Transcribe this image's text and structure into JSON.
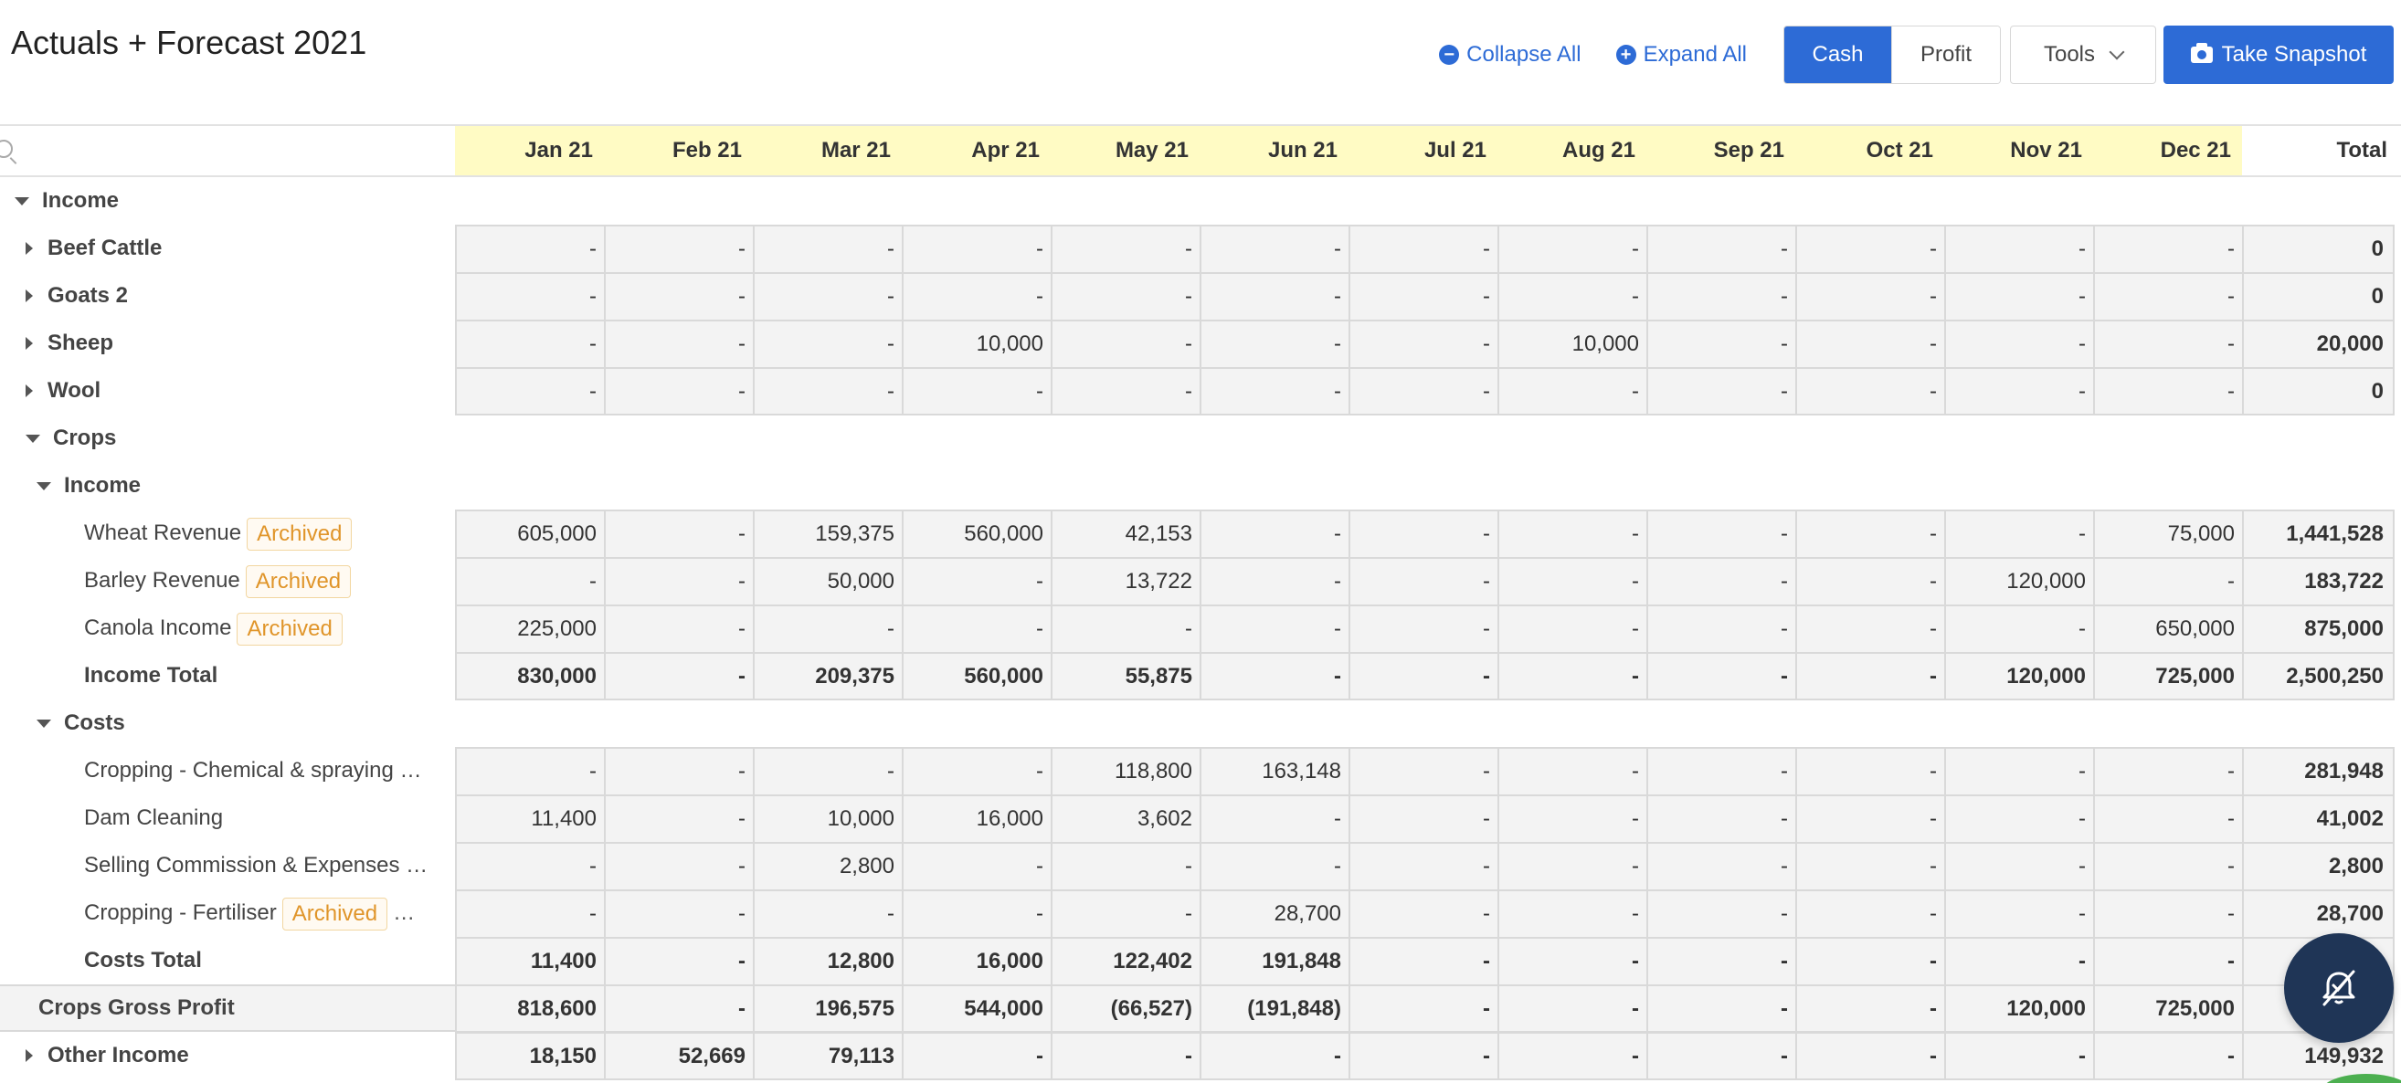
{
  "title": "Actuals + Forecast 2021",
  "toolbar": {
    "collapse_all": "Collapse All",
    "expand_all": "Expand All",
    "cash": "Cash",
    "profit": "Profit",
    "tools": "Tools",
    "take_snapshot": "Take Snapshot"
  },
  "search": {
    "placeholder": ""
  },
  "months": [
    "Jan 21",
    "Feb 21",
    "Mar 21",
    "Apr 21",
    "May 21",
    "Jun 21",
    "Jul 21",
    "Aug 21",
    "Sep 21",
    "Oct 21",
    "Nov 21",
    "Dec 21"
  ],
  "total_label": "Total",
  "badge_text": "Archived",
  "rows": [
    {
      "kind": "section",
      "label": "Income",
      "caret": "down",
      "indent": 0,
      "bold": true
    },
    {
      "kind": "data",
      "label": "Beef Cattle",
      "caret": "right",
      "indent": 1,
      "bold": true,
      "values": [
        "-",
        "-",
        "-",
        "-",
        "-",
        "-",
        "-",
        "-",
        "-",
        "-",
        "-",
        "-"
      ],
      "total": "0"
    },
    {
      "kind": "data",
      "label": "Goats 2",
      "caret": "right",
      "indent": 1,
      "bold": true,
      "values": [
        "-",
        "-",
        "-",
        "-",
        "-",
        "-",
        "-",
        "-",
        "-",
        "-",
        "-",
        "-"
      ],
      "total": "0"
    },
    {
      "kind": "data",
      "label": "Sheep",
      "caret": "right",
      "indent": 1,
      "bold": true,
      "values": [
        "-",
        "-",
        "-",
        "10,000",
        "-",
        "-",
        "-",
        "10,000",
        "-",
        "-",
        "-",
        "-"
      ],
      "total": "20,000"
    },
    {
      "kind": "data",
      "label": "Wool",
      "caret": "right",
      "indent": 1,
      "bold": true,
      "values": [
        "-",
        "-",
        "-",
        "-",
        "-",
        "-",
        "-",
        "-",
        "-",
        "-",
        "-",
        "-"
      ],
      "total": "0",
      "last": true
    },
    {
      "kind": "section",
      "label": "Crops",
      "caret": "down",
      "indent": 1,
      "bold": true
    },
    {
      "kind": "section",
      "label": "Income",
      "caret": "down",
      "indent": 2,
      "bold": true
    },
    {
      "kind": "data",
      "label": "Wheat Revenue",
      "archived": true,
      "indent": 3,
      "values": [
        "605,000",
        "-",
        "159,375",
        "560,000",
        "42,153",
        "-",
        "-",
        "-",
        "-",
        "-",
        "-",
        "75,000"
      ],
      "total": "1,441,528"
    },
    {
      "kind": "data",
      "label": "Barley Revenue",
      "archived": true,
      "indent": 3,
      "values": [
        "-",
        "-",
        "50,000",
        "-",
        "13,722",
        "-",
        "-",
        "-",
        "-",
        "-",
        "120,000",
        "-"
      ],
      "total": "183,722"
    },
    {
      "kind": "data",
      "label": "Canola Income",
      "archived": true,
      "indent": 3,
      "values": [
        "225,000",
        "-",
        "-",
        "-",
        "-",
        "-",
        "-",
        "-",
        "-",
        "-",
        "-",
        "650,000"
      ],
      "total": "875,000"
    },
    {
      "kind": "data",
      "label": "Income Total",
      "indent": 3,
      "bold": true,
      "boldcells": true,
      "values": [
        "830,000",
        "-",
        "209,375",
        "560,000",
        "55,875",
        "-",
        "-",
        "-",
        "-",
        "-",
        "120,000",
        "725,000"
      ],
      "total": "2,500,250",
      "last": true
    },
    {
      "kind": "section",
      "label": "Costs",
      "caret": "down",
      "indent": 2,
      "bold": true
    },
    {
      "kind": "data",
      "label": "Cropping - Chemical & spraying …",
      "indent": 3,
      "values": [
        "-",
        "-",
        "-",
        "-",
        "118,800",
        "163,148",
        "-",
        "-",
        "-",
        "-",
        "-",
        "-"
      ],
      "total": "281,948"
    },
    {
      "kind": "data",
      "label": "Dam Cleaning",
      "indent": 3,
      "values": [
        "11,400",
        "-",
        "10,000",
        "16,000",
        "3,602",
        "-",
        "-",
        "-",
        "-",
        "-",
        "-",
        "-"
      ],
      "total": "41,002"
    },
    {
      "kind": "data",
      "label": "Selling Commission & Expenses …",
      "indent": 3,
      "values": [
        "-",
        "-",
        "2,800",
        "-",
        "-",
        "-",
        "-",
        "-",
        "-",
        "-",
        "-",
        "-"
      ],
      "total": "2,800"
    },
    {
      "kind": "data",
      "label": "Cropping - Fertiliser",
      "archived": true,
      "ellipsis": "…",
      "indent": 3,
      "values": [
        "-",
        "-",
        "-",
        "-",
        "-",
        "28,700",
        "-",
        "-",
        "-",
        "-",
        "-",
        "-"
      ],
      "total": "28,700"
    },
    {
      "kind": "data",
      "label": "Costs Total",
      "indent": 3,
      "bold": true,
      "boldcells": true,
      "values": [
        "11,400",
        "-",
        "12,800",
        "16,000",
        "122,402",
        "191,848",
        "-",
        "-",
        "-",
        "-",
        "-",
        "-"
      ],
      "total": ""
    },
    {
      "kind": "data",
      "label": "Crops Gross Profit",
      "indent": 4,
      "bold": true,
      "boldcells": true,
      "gp": true,
      "values": [
        "818,600",
        "-",
        "196,575",
        "544,000",
        "(66,527)",
        "(191,848)",
        "-",
        "-",
        "-",
        "-",
        "120,000",
        "725,000"
      ],
      "total": "2"
    },
    {
      "kind": "data",
      "label": "Other Income",
      "caret": "right",
      "indent": 1,
      "bold": true,
      "boldcells": true,
      "values": [
        "18,150",
        "52,669",
        "79,113",
        "-",
        "-",
        "-",
        "-",
        "-",
        "-",
        "-",
        "-",
        "-"
      ],
      "total": "149,932"
    }
  ]
}
